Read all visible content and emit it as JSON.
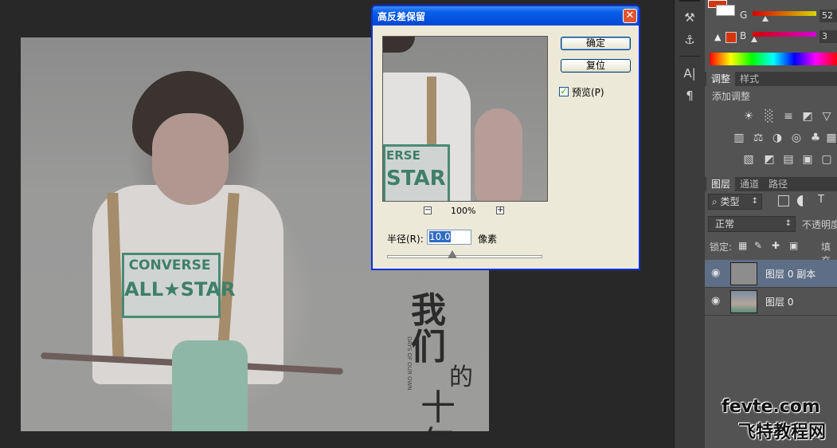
{
  "canvas": {
    "shirt_logo_line1": "CONVERSE",
    "shirt_logo_line2": "ALL★STAR",
    "calligraphy": [
      "我们",
      "的",
      "十",
      "年"
    ],
    "calligraphy_sub": "DAYS OF OUR OWN"
  },
  "dialog": {
    "title": "高反差保留",
    "close_glyph": "✕",
    "ok_label": "确定",
    "reset_label": "复位",
    "preview_checkbox": {
      "label": "预览(P)",
      "checked": true,
      "check_glyph": "✓"
    },
    "preview_image": {
      "logo_line1": "ERSE",
      "logo_line2": "STAR"
    },
    "zoom": {
      "minus": "−",
      "value": "100%",
      "plus": "+"
    },
    "radius": {
      "label": "半径(R):",
      "value": "10.0",
      "unit": "像素",
      "slider_fraction": 0.42
    }
  },
  "color_panel": {
    "g_label": "G",
    "g_value": "52",
    "b_label": "B",
    "b_value": "3",
    "warning_icon": "▲",
    "foreground_color": "#d6340d",
    "background_color": "#ffffff"
  },
  "adjustments_panel": {
    "tabs": [
      "调整",
      "样式"
    ],
    "add_label": "添加调整",
    "row1_icons": [
      "☀",
      "░",
      "≡",
      "◩",
      "▽"
    ],
    "row2_icons": [
      "▥",
      "⚖",
      "◑",
      "◎",
      "♣",
      "▦"
    ],
    "row3_icons": [
      "▧",
      "◩",
      "▤",
      "▣",
      "▢"
    ]
  },
  "layers_panel": {
    "tabs": [
      "图层",
      "通道",
      "路径"
    ],
    "filter_label": "⌕ 类型",
    "filter_arrow": "↕",
    "blend_mode": "正常",
    "opacity_label": "不透明度",
    "lock_label": "锁定:",
    "lock_icons": [
      "▦",
      "✎",
      "✚",
      "▣"
    ],
    "fill_label": "填充",
    "layers": [
      {
        "name": "图层 0 副本",
        "visible_glyph": "◉",
        "selected": true
      },
      {
        "name": "图层 0",
        "visible_glyph": "◉",
        "selected": false
      }
    ]
  },
  "tool_strip": {
    "icons": [
      "⚒",
      "⚓",
      "A|",
      "¶"
    ]
  },
  "watermark": {
    "latin": "fevte.com",
    "cjk": "飞特教程网"
  }
}
